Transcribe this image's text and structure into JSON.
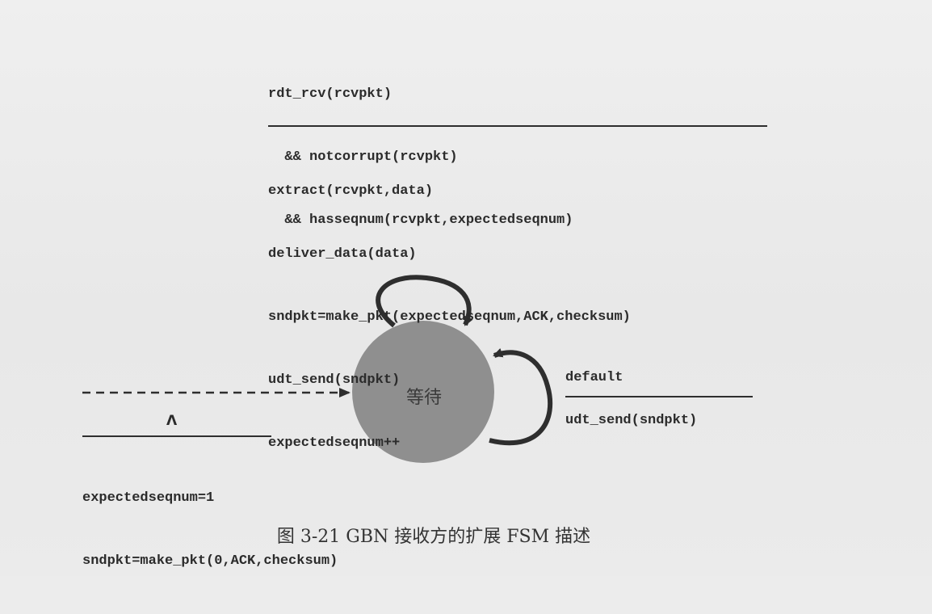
{
  "top_transition": {
    "event_lines": [
      "rdt_rcv(rcvpkt)",
      "  && notcorrupt(rcvpkt)",
      "  && hasseqnum(rcvpkt,expectedseqnum)"
    ],
    "action_lines": [
      "extract(rcvpkt,data)",
      "deliver_data(data)",
      "sndpkt=make_pkt(expectedseqnum,ACK,checksum)",
      "udt_send(sndpkt)",
      "expectedseqnum++"
    ]
  },
  "state": {
    "label": "等待"
  },
  "default_transition": {
    "event": "default",
    "action": "udt_send(sndpkt)"
  },
  "initial_transition": {
    "event": "Λ",
    "action_lines": [
      "expectedseqnum=1",
      "sndpkt=make_pkt(0,ACK,checksum)"
    ]
  },
  "caption": "图 3-21   GBN 接收方的扩展 FSM 描述",
  "colors": {
    "state_fill": "#8f8f8f",
    "stroke": "#2e2e2e",
    "background": "#ececec"
  }
}
